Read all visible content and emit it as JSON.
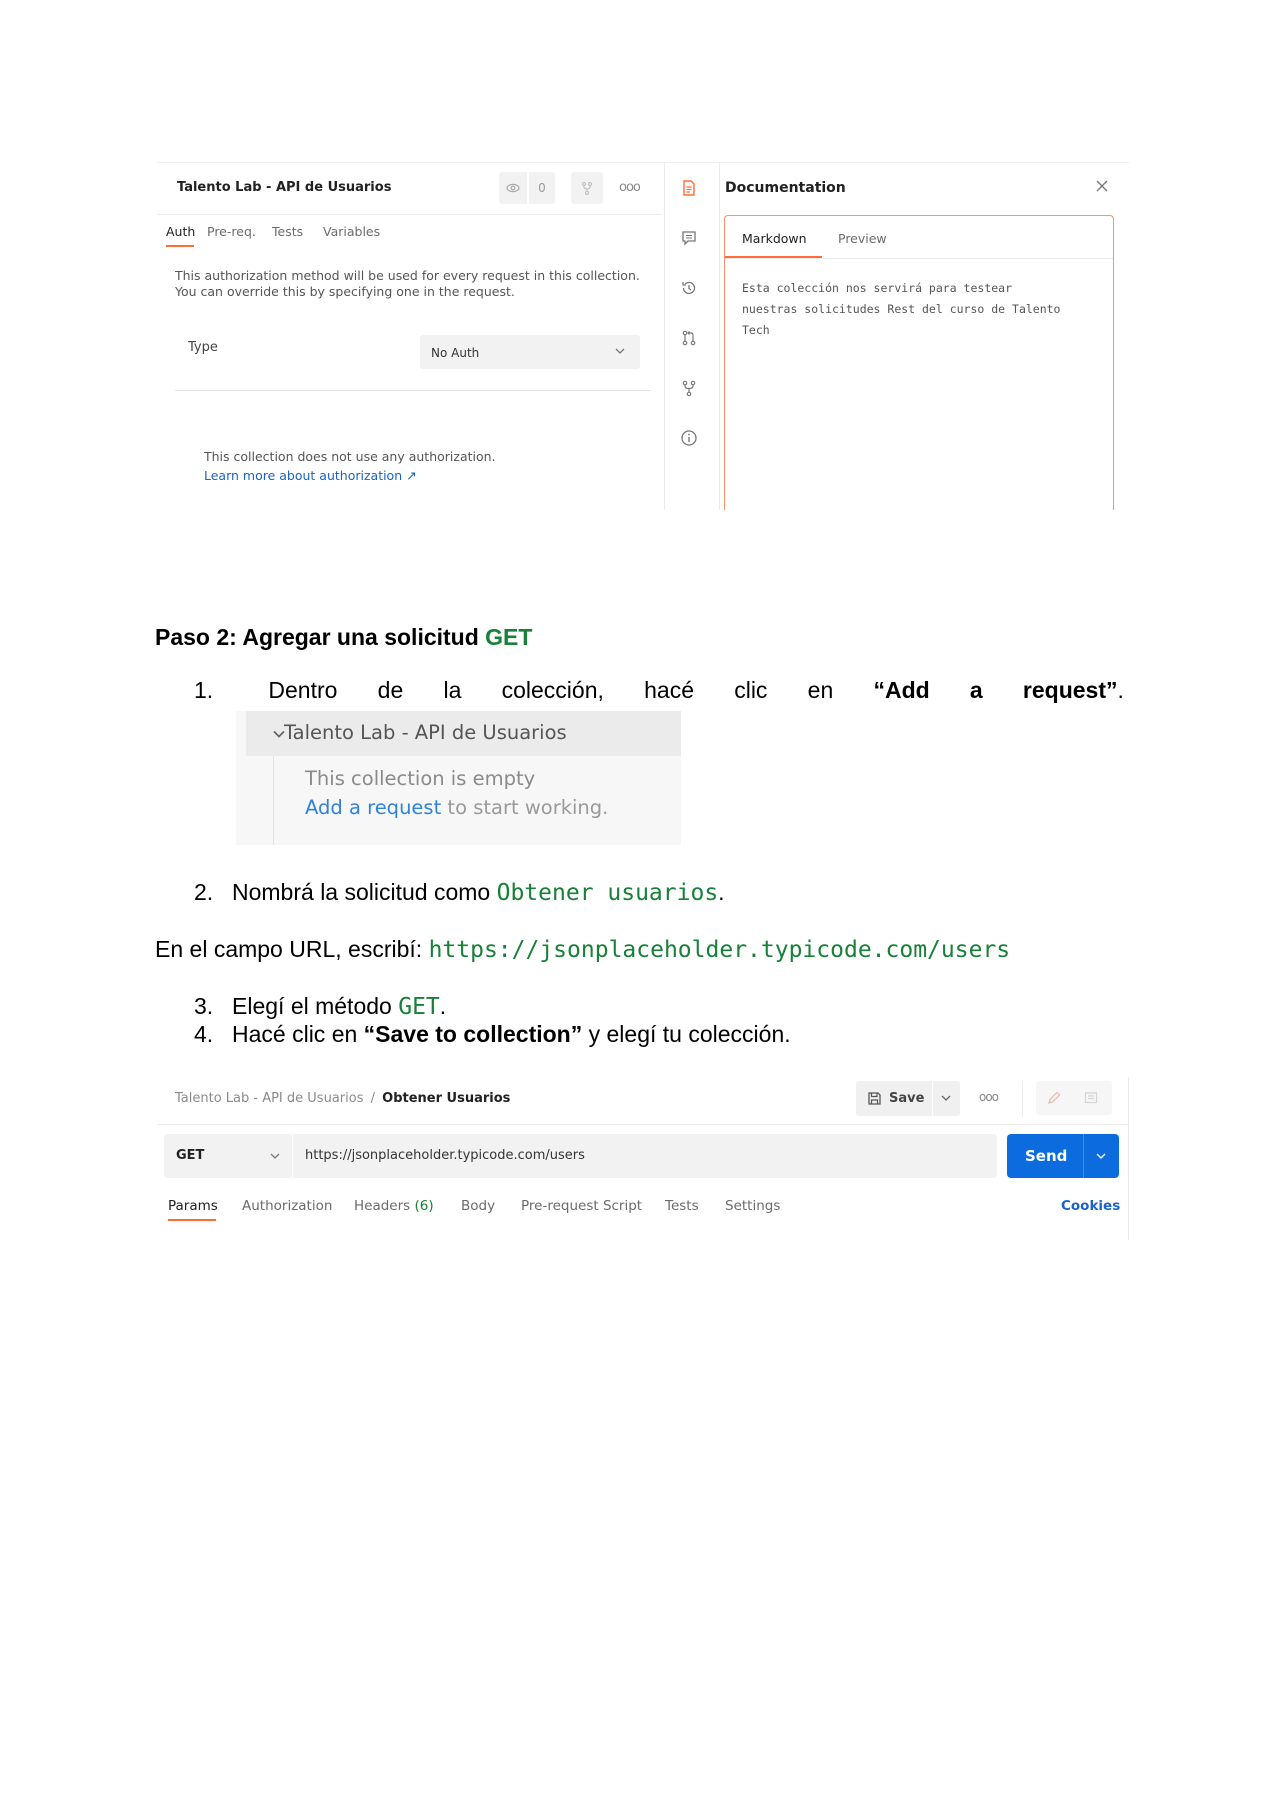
{
  "shot1": {
    "collection_title": "Talento Lab - API de Usuarios",
    "watch_count": "0",
    "tabs": [
      "Auth",
      "Pre-req.",
      "Tests",
      "Variables"
    ],
    "description": "This authorization method will be used for every request in this collection. You can override this by specifying one in the request.",
    "type_label": "Type",
    "type_value": "No Auth",
    "no_auth_text": "This collection does not use any authorization.",
    "learn_more": "Learn more about authorization ↗",
    "doc_title": "Documentation",
    "doc_tabs": [
      "Markdown",
      "Preview"
    ],
    "doc_lines": [
      "Esta colección nos servirá para testear",
      "nuestras solicitudes Rest del curso de Talento",
      "Tech"
    ]
  },
  "step": {
    "heading_text": "Paso 2: Agregar una solicitud ",
    "heading_code": "GET",
    "item1_num": "1.",
    "item1_words": [
      "Dentro",
      "de",
      "la",
      "colección,",
      "hacé",
      "clic",
      "en"
    ],
    "item1_bold": [
      "“Add",
      "a",
      "request”"
    ],
    "item1_end": ".",
    "item2_num": "2.",
    "item2_text": "Nombrá la solicitud como ",
    "item2_code": "Obtener usuarios",
    "item2_end": ".",
    "url_text": "En el campo URL, escribí: ",
    "url_code": "https://jsonplaceholder.typicode.com/users",
    "item3_num": "3.",
    "item3_text": "Elegí el método ",
    "item3_code": "GET",
    "item3_end": ".",
    "item4_num": "4.",
    "item4_text": "Hacé clic en ",
    "item4_bold": "“Save to collection”",
    "item4_end": " y elegí tu colección."
  },
  "shot2": {
    "collection_title": "Talento Lab - API de Usuarios",
    "empty_text": "This collection is empty",
    "add_link": "Add a request",
    "add_rest": " to start working."
  },
  "shot3": {
    "breadcrumb_parent": "Talento Lab - API de Usuarios",
    "breadcrumb_sep": "/",
    "breadcrumb_current": "Obtener Usuarios",
    "save_label": "Save",
    "method": "GET",
    "url": "https://jsonplaceholder.typicode.com/users",
    "send_label": "Send",
    "tabs": [
      "Params",
      "Authorization",
      "Headers",
      "Body",
      "Pre-request Script",
      "Tests",
      "Settings"
    ],
    "headers_count": "(6)",
    "cookies_label": "Cookies",
    "colors": {
      "send": "#0c6cdd",
      "accent": "#ff6c37",
      "headers_count": "#188038"
    }
  }
}
